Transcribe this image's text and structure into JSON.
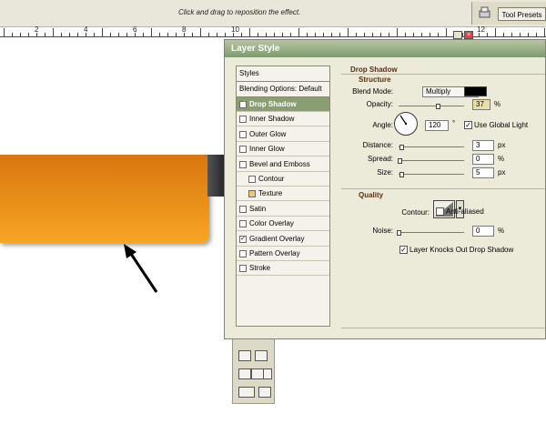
{
  "optionsbar": {
    "hint": "Click and drag to reposition the effect.",
    "tool_presets_label": "Tool Presets",
    "tool_presets_icon": "tool-presets-icon"
  },
  "ruler": {
    "numbers": [
      "2",
      "4",
      "6",
      "8",
      "10",
      "12"
    ]
  },
  "colors": {
    "orange_top": "#d8760e",
    "orange_bottom": "#f7a525",
    "titlebar": "#8a9e74",
    "group_title": "#5a2f11"
  },
  "dialog": {
    "title": "Layer Style",
    "styles_header": "Styles",
    "blending_options": "Blending Options: Default",
    "styles": [
      {
        "label": "Drop Shadow",
        "checked": true,
        "selected": true
      },
      {
        "label": "Inner Shadow",
        "checked": false
      },
      {
        "label": "Outer Glow",
        "checked": false
      },
      {
        "label": "Inner Glow",
        "checked": false
      },
      {
        "label": "Bevel and Emboss",
        "checked": false
      },
      {
        "label": "Contour",
        "checked": false,
        "sub": true
      },
      {
        "label": "Texture",
        "checked": false,
        "sub": true
      },
      {
        "label": "Satin",
        "checked": false
      },
      {
        "label": "Color Overlay",
        "checked": false
      },
      {
        "label": "Gradient Overlay",
        "checked": true
      },
      {
        "label": "Pattern Overlay",
        "checked": false
      },
      {
        "label": "Stroke",
        "checked": false
      }
    ],
    "drop_shadow": {
      "title": "Drop Shadow",
      "structure_title": "Structure",
      "blend_mode_label": "Blend Mode:",
      "blend_mode_value": "Multiply",
      "shadow_color": "#000000",
      "opacity_label": "Opacity:",
      "opacity_value": "37",
      "opacity_unit": "%",
      "angle_label": "Angle:",
      "angle_value": "120",
      "angle_unit": "°",
      "use_global_light_label": "Use Global Light",
      "use_global_light": true,
      "distance_label": "Distance:",
      "distance_value": "3",
      "distance_unit": "px",
      "spread_label": "Spread:",
      "spread_value": "0",
      "spread_unit": "%",
      "size_label": "Size:",
      "size_value": "5",
      "size_unit": "px",
      "quality_title": "Quality",
      "contour_label": "Contour:",
      "anti_aliased_label": "Anti-aliased",
      "anti_aliased": false,
      "noise_label": "Noise:",
      "noise_value": "0",
      "noise_unit": "%",
      "knockout_label": "Layer Knocks Out Drop Shadow",
      "knockout": true
    }
  }
}
